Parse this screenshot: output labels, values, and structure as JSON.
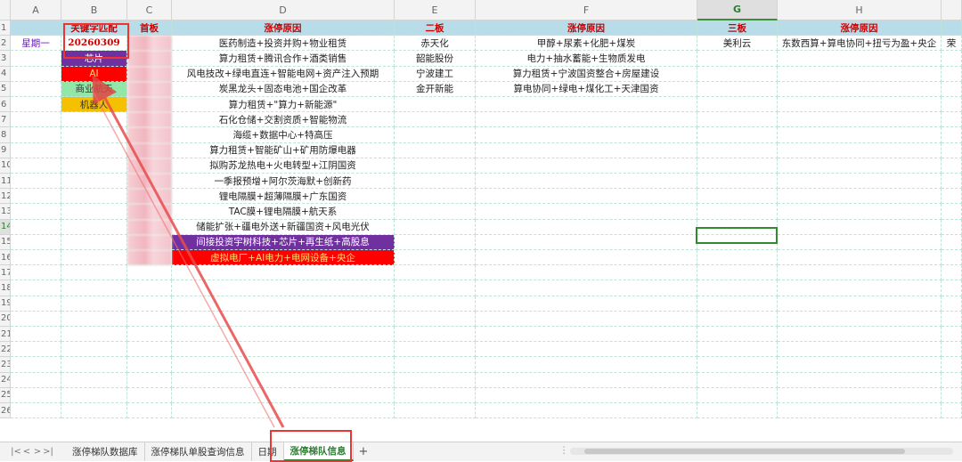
{
  "columns": [
    "A",
    "B",
    "C",
    "D",
    "E",
    "F",
    "G",
    "H",
    ""
  ],
  "selected_column": "G",
  "row_numbers": [
    "1",
    "2",
    "3",
    "4",
    "5",
    "6",
    "7",
    "8",
    "9",
    "10",
    "11",
    "12",
    "13",
    "14",
    "15",
    "16",
    "17",
    "18",
    "19",
    "20",
    "21",
    "22",
    "23",
    "24",
    "25",
    "26"
  ],
  "selected_row": "14",
  "header_row": {
    "b": "关键字匹配",
    "c": "首板",
    "d": "涨停原因",
    "e": "二板",
    "f": "涨停原因",
    "g": "三板",
    "h": "涨停原因"
  },
  "row2": {
    "a": "星期一",
    "b": "20260309",
    "d": "医药制造+投资并购+物业租赁",
    "e": "赤天化",
    "f": "甲醇+尿素+化肥+煤炭",
    "g": "美利云",
    "h": "东数西算+算电协同+扭亏为盈+央企",
    "i": "荣"
  },
  "keyword_tags": [
    {
      "label": "芯片",
      "style": "purple"
    },
    {
      "label": "AI",
      "style": "red"
    },
    {
      "label": "商业航天",
      "style": "green"
    },
    {
      "label": "机器人",
      "style": "amber"
    }
  ],
  "first_board_reasons": [
    "医药制造+投资并购+物业租赁",
    "算力租赁+腾讯合作+酒类销售",
    "风电技改+绿电直连+智能电网+资产注入预期",
    "炭黑龙头+固态电池+国企改革",
    "算力租赁+\"算力+新能源\"",
    "石化仓储+交割资质+智能物流",
    "海缆+数据中心+特高压",
    "算力租赁+智能矿山+矿用防爆电器",
    "拟购苏龙热电+火电转型+江阴国资",
    "一季报预增+阿尔茨海默+创新药",
    "锂电隔膜+超薄隔膜+广东国资",
    "TAC膜+锂电隔膜+航天系",
    "储能扩张+疆电外送+新疆国资+风电光伏",
    "间接投资宇树科技+芯片+再生纸+高股息",
    "虚拟电厂+AI电力+电网设备+央企"
  ],
  "second_board": [
    {
      "name": "赤天化",
      "reason": "甲醇+尿素+化肥+煤炭"
    },
    {
      "name": "韶能股份",
      "reason": "电力+抽水蓄能+生物质发电"
    },
    {
      "name": "宁波建工",
      "reason": "算力租赁+宁波国资整合+房屋建设"
    },
    {
      "name": "金开新能",
      "reason": "算电协同+绿电+煤化工+天津国资"
    }
  ],
  "sheet_tabs": [
    "涨停梯队数据库",
    "涨停梯队单股查询信息",
    "日期",
    "涨停梯队信息"
  ],
  "active_tab": "涨停梯队信息",
  "nav_icons": [
    "first-icon",
    "prev-icon",
    "next-icon",
    "last-icon"
  ],
  "colors": {
    "header_bg": "#b8dde9",
    "header_text": "#d10000",
    "accent": "#2e7d32",
    "annotation": "#e33333"
  }
}
